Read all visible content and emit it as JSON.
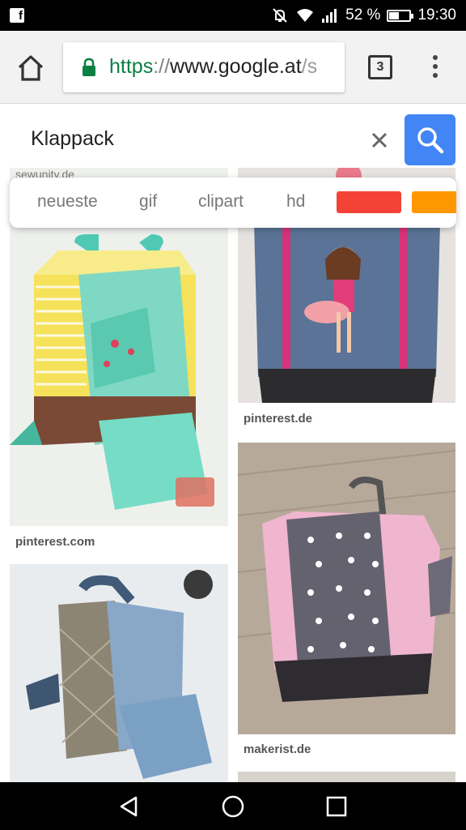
{
  "status_bar": {
    "battery_percent": "52 %",
    "battery_level": 0.52,
    "time": "19:30",
    "icons": [
      "facebook-notification-icon",
      "mute-icon",
      "wifi-icon",
      "signal-icon",
      "battery-icon"
    ]
  },
  "browser": {
    "url": {
      "scheme": "https",
      "separator": "://",
      "host": "www.google.at",
      "path": "/s"
    },
    "tab_count": "3",
    "icons": [
      "home-icon",
      "lock-icon",
      "tab-switcher-icon",
      "overflow-menu-icon"
    ]
  },
  "search": {
    "query": "Klappack",
    "icons": [
      "clear-icon",
      "search-icon"
    ]
  },
  "filters": {
    "chips": [
      "neueste",
      "gif",
      "clipart",
      "hd"
    ],
    "color_swatches": [
      "#f44336",
      "#ff9800"
    ]
  },
  "results": [
    {
      "source": "sewunity.de"
    },
    {
      "source": "pinterest.com"
    },
    {
      "source": "pinterest.de"
    },
    {
      "source": "makerist.de"
    },
    {
      "source": ""
    }
  ],
  "nav_bar": {
    "icons": [
      "back-icon",
      "home-circle-icon",
      "recent-apps-icon"
    ]
  },
  "colors": {
    "accent_blue": "#4285f4",
    "secure_green": "#0b8043"
  }
}
